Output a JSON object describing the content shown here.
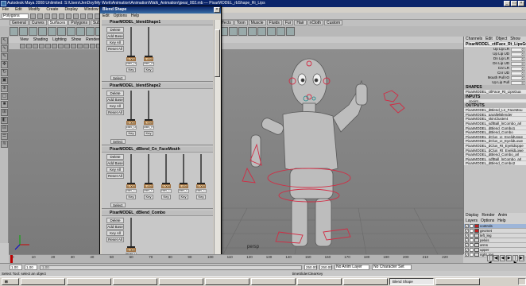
{
  "app": {
    "title": "Autodesk Maya 2008 Unlimited: S:\\Users\\JenDoy\\My Work\\Animation\\Animation\\Walk_Animation\\jpeai_002.mb  ---  PixarMODEL_rbShape_Ri_Lips",
    "menu": [
      "File",
      "Edit",
      "Modify",
      "Create",
      "Display",
      "Window",
      "Assets",
      "Anim"
    ],
    "mode_select": "Polygons"
  },
  "shelf": {
    "tabs": [
      "General",
      "Curves",
      "Surfaces",
      "Polygons",
      "Subdivs",
      "Deformation",
      "Animation",
      "Dynamics",
      "Rendering",
      "PaintEffects",
      "Toon",
      "Muscle",
      "Fluids",
      "Fur",
      "Hair",
      "nCloth",
      "Custom"
    ],
    "active_tab": "Surfaces"
  },
  "viewport": {
    "menu": [
      "View",
      "Shading",
      "Lighting",
      "Show",
      "Renderer",
      "Panels"
    ],
    "camera": "persp"
  },
  "blend_shape": {
    "title": "Blend Shape",
    "close": "×",
    "menu": [
      "Edit",
      "Options",
      "Help"
    ],
    "buttons": [
      "Delete",
      "Add Base",
      "Key All",
      "Reset All"
    ],
    "select_label": "Select",
    "key_label": "Key",
    "groups": [
      {
        "name": "PixarMODEL_blendShape1",
        "targets": [
          {
            "value": "0.000",
            "name": "ciBS_Lt_K"
          },
          {
            "value": "0.000",
            "name": "ciBS_Lt_K"
          }
        ]
      },
      {
        "name": "PixarMODEL_blendShape2",
        "targets": [
          {
            "value": "0.000",
            "name": "ciBS_Lt_K"
          },
          {
            "value": "0.000",
            "name": "ciBS_Rt_K"
          }
        ]
      },
      {
        "name": "PixarMODEL_dBlend_Cn_FaceMouth",
        "targets": [
          {
            "value": "0.000",
            "name": "ciBS_Cn_f"
          },
          {
            "value": "0.000",
            "name": "ciBS_Cn_f"
          },
          {
            "value": "0.000",
            "name": "ciBS_Cn_f"
          },
          {
            "value": "0.000",
            "name": "ciBS_Cn_f"
          },
          {
            "value": "0.000",
            "name": "ciBS_Cn_f"
          }
        ]
      },
      {
        "name": "PixarMODEL_dBlend_Combo",
        "targets": [
          {
            "value": "0.000",
            "name": "Brow_Lt_K"
          }
        ]
      }
    ]
  },
  "channel_box": {
    "menu": [
      "Channels",
      "Edit",
      "Object",
      "Show"
    ],
    "object": "PixarMODEL_ctlFace_Rt_LipsGua",
    "channels": [
      {
        "label": "Up Lip LR",
        "value": "0"
      },
      {
        "label": "Up Lip UD",
        "value": "0"
      },
      {
        "label": "Dn Lip LR",
        "value": "0"
      },
      {
        "label": "Dn Lip UD",
        "value": "0"
      },
      {
        "label": "Cnr LR",
        "value": "0"
      },
      {
        "label": "Cnr UD",
        "value": "0"
      },
      {
        "label": "Mouth Pull IO",
        "value": "0"
      },
      {
        "label": "Up Lip Pull",
        "value": "0"
      }
    ],
    "shapes_header": "SHAPES",
    "shape_item": "PixarMODEL_ctlFace_Rt_LipsGua",
    "inputs_header": "INPUTS",
    "inputs": [
      "...cpoint..."
    ],
    "outputs_header": "OUTPUTS",
    "outputs": [
      "PixarMODEL_dBlend_Ln_FaceMou",
      "PixarMODEL_parallelBlender",
      "PixarMODEL_skinCluster4",
      "PixarMODEL_sdfBall_lnCombo_arl",
      "PixarMODEL_dBlend_Combo1",
      "PixarMODEL_dBlend_Combo",
      "PixarMODEL_dClus_Lt_EyelidUppe",
      "PixarMODEL_dClus_Lt_EyelidLowe",
      "PixarMODEL_dClus_Rt_EyelidUppe",
      "PixarMODEL_dClus_Rt_EyelidLowe",
      "PixarMODEL_dBlend_Combo_arl",
      "PixarMODEL_sdfBall_lnCombo_arl",
      "PixarMODEL_dBlend_Combo2"
    ]
  },
  "layers": {
    "tabs": [
      "Display",
      "Render",
      "Anim"
    ],
    "menu": [
      "Layers",
      "Options",
      "Help"
    ],
    "items": [
      {
        "name": "controls",
        "color": "#c02020",
        "selected": true
      },
      {
        "name": "geomet",
        "color": "#c02020",
        "selected": false
      },
      {
        "name": "left_leg",
        "color": "#d8d8d8",
        "selected": false
      },
      {
        "name": "pelvis",
        "color": "#d8d8d8",
        "selected": false
      },
      {
        "name": "arms",
        "color": "#d8d8d8",
        "selected": false
      },
      {
        "name": "upper",
        "color": "#d8d8d8",
        "selected": false
      },
      {
        "name": "right_leg",
        "color": "#d8d8d8",
        "selected": false
      }
    ]
  },
  "timeline": {
    "ticks": [
      "0",
      "10",
      "20",
      "30",
      "40",
      "50",
      "60",
      "70",
      "80",
      "90",
      "100",
      "110",
      "120",
      "130",
      "140",
      "150",
      "160",
      "170",
      "180",
      "190",
      "200",
      "210",
      "220"
    ],
    "current": "0.00"
  },
  "range": {
    "start": "1.00",
    "end": "250.00",
    "range_start": "1.00",
    "range_end": "250.00",
    "anim_layer": "No Anim Layer",
    "character": "No Character Set"
  },
  "help_line": {
    "left": "Select Tool: select an object",
    "mid": "timeSliderClearKey"
  },
  "taskbar": {
    "items": [
      "",
      "",
      "",
      "",
      "",
      "",
      "",
      "",
      "Blend Shape",
      ""
    ],
    "tray": ""
  }
}
